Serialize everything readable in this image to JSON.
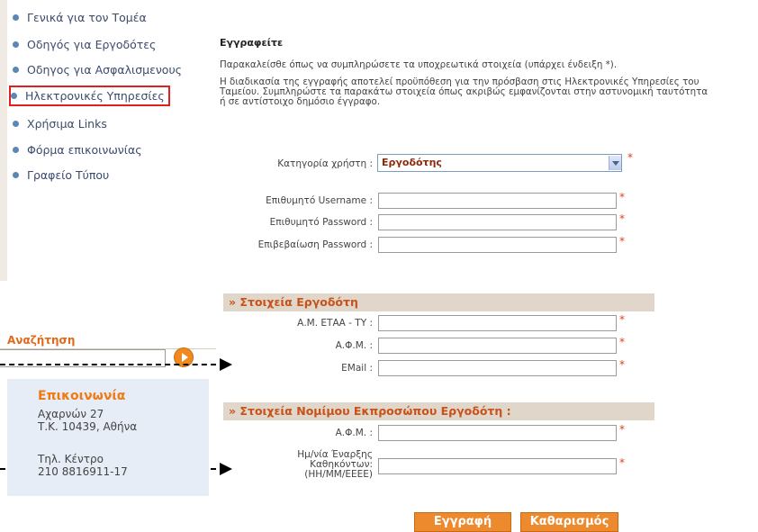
{
  "nav": {
    "items": [
      {
        "label": "Γενικά για τον Τομέα"
      },
      {
        "label": "Οδηγός για Εργοδότες"
      },
      {
        "label": "Οδηγος για Ασφαλισμενους"
      },
      {
        "label": "Ηλεκτρονικές Υπηρεσίες"
      },
      {
        "label": "Χρήσιμα Links"
      },
      {
        "label": "Φόρμα επικοινωνίας"
      },
      {
        "label": "Γραφείο Τύπου"
      }
    ]
  },
  "search": {
    "label": "Αναζήτηση",
    "value": ""
  },
  "contact": {
    "title": "Επικοινωνία",
    "address_line1": "Αχαρνών 27",
    "address_line2": "Τ.Κ. 10439, Αθήνα",
    "phone_label": "Τηλ. Κέντρο",
    "phone_number": "210 8816911-17"
  },
  "form": {
    "title": "Εγγραφείτε",
    "intro1": "Παρακαλείσθε όπως να συμπληρώσετε τα υποχρεωτικά στοιχεία (υπάρχει ένδειξη *).",
    "intro2_line1": "Η διαδικασία της εγγραφής αποτελεί προϋπόθεση για την πρόσβαση στις Ηλεκτρονικές Υπηρεσίες του",
    "intro2_line2": "Ταμείου. Συμπληρώστε τα παρακάτω στοιχεία όπως ακριβώς εμφανίζονται στην αστυνομική ταυτότητα",
    "intro2_line3": "ή σε αντίστοιχο δημόσιο έγγραφο.",
    "required_mark": "*",
    "user_category": {
      "label": "Κατηγορία χρήστη :",
      "selected": "Εργοδότης"
    },
    "username": {
      "label": "Επιθυμητό Username :",
      "value": ""
    },
    "password": {
      "label": "Επιθυμητό Password :",
      "value": ""
    },
    "password_confirm": {
      "label": "Επιβεβαίωση Password :",
      "value": ""
    },
    "employer_section": "» Στοιχεία Εργοδότη",
    "am_etaa": {
      "label": "Α.Μ. ΕΤΑΑ - ΤΥ :",
      "value": ""
    },
    "afm": {
      "label": "Α.Φ.Μ. :",
      "value": ""
    },
    "email": {
      "label": "EMail :",
      "value": ""
    },
    "rep_section": "» Στοιχεία Νομίμου Εκπροσώπου Εργοδότη :",
    "rep_afm": {
      "label": "Α.Φ.Μ. :",
      "value": ""
    },
    "rep_date": {
      "label_line1": "Ημ/νία Έναρξης",
      "label_line2": "Καθηκόντων:",
      "label_line3": "(ΗΗ/ΜΜ/ΕΕΕΕ)",
      "value": ""
    },
    "submit_label": "Εγγραφή",
    "reset_label": "Καθαρισμός"
  }
}
